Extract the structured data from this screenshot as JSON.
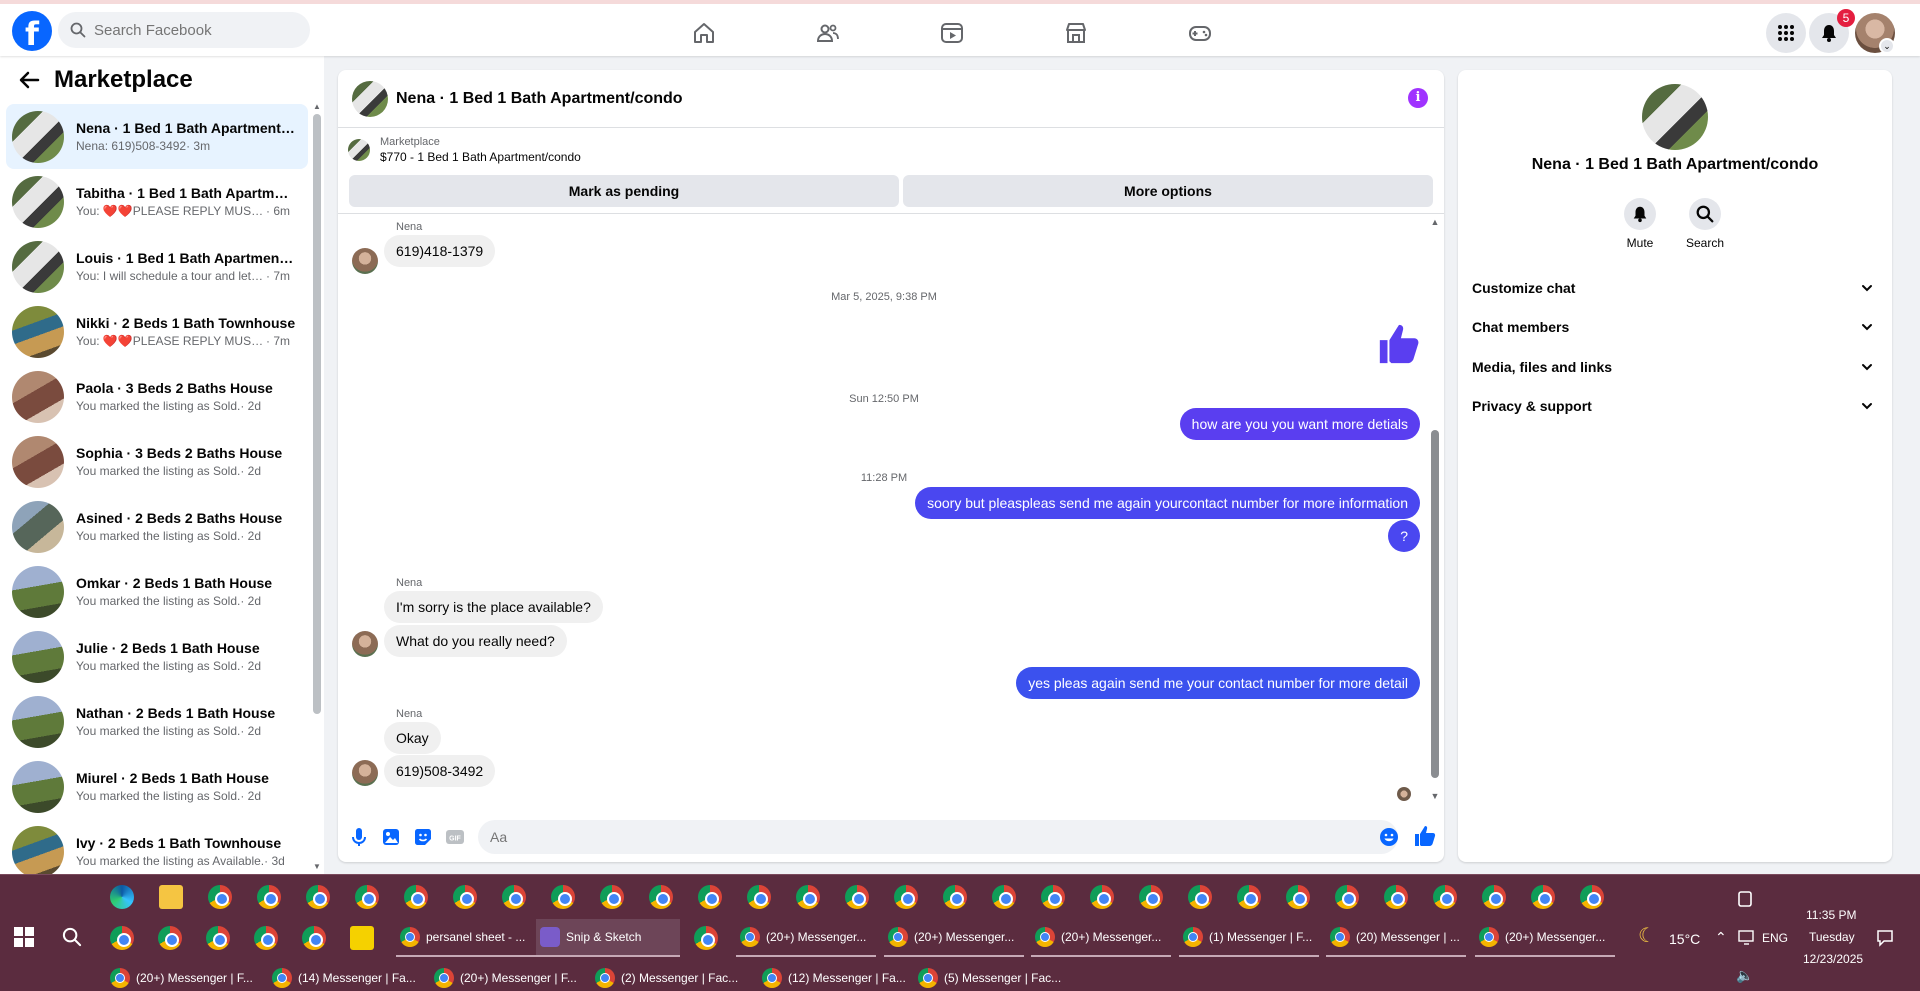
{
  "topbar": {
    "logo": "f",
    "search_placeholder": "Search Facebook",
    "notifications_count": "5"
  },
  "sidebar": {
    "title": "Marketplace",
    "chats": [
      {
        "name": "Nena · 1 Bed 1 Bath Apartment/condo",
        "preview": "Nena: 619)508-3492",
        "time": " · 3m",
        "active": true,
        "photo": "sb-photo-1"
      },
      {
        "name": "Tabitha · 1 Bed 1 Bath Apartment/condo",
        "preview": "You: ❤️❤️PLEASE REPLY MUST WANT",
        "time": " · 6m",
        "active": false,
        "photo": "sb-photo-1"
      },
      {
        "name": "Louis · 1 Bed 1 Bath Apartment/condo",
        "preview": "You: I will schedule a tour and let you",
        "time": " · 7m",
        "active": false,
        "photo": "sb-photo-1"
      },
      {
        "name": "Nikki · 2 Beds 1 Bath Townhouse",
        "preview": "You: ❤️❤️PLEASE REPLY MUST WANT",
        "time": " · 7m",
        "active": false,
        "photo": "sb-photo-2"
      },
      {
        "name": "Paola · 3 Beds 2 Baths House",
        "preview": "You marked the listing as Sold.",
        "time": " · 2d",
        "active": false,
        "photo": "sb-photo-3"
      },
      {
        "name": "Sophia · 3 Beds 2 Baths House",
        "preview": "You marked the listing as Sold.",
        "time": " · 2d",
        "active": false,
        "photo": "sb-photo-3"
      },
      {
        "name": "Asined · 2 Beds 2 Baths House",
        "preview": "You marked the listing as Sold.",
        "time": " · 2d",
        "active": false,
        "photo": "sb-photo-4"
      },
      {
        "name": "Omkar · 2 Beds 1 Bath House",
        "preview": "You marked the listing as Sold.",
        "time": " · 2d",
        "active": false,
        "photo": "sb-photo-5"
      },
      {
        "name": "Julie · 2 Beds 1 Bath House",
        "preview": "You marked the listing as Sold.",
        "time": " · 2d",
        "active": false,
        "photo": "sb-photo-5"
      },
      {
        "name": "Nathan · 2 Beds 1 Bath House",
        "preview": "You marked the listing as Sold.",
        "time": " · 2d",
        "active": false,
        "photo": "sb-photo-5"
      },
      {
        "name": "Miurel · 2 Beds 1 Bath House",
        "preview": "You marked the listing as Sold.",
        "time": " · 2d",
        "active": false,
        "photo": "sb-photo-5"
      },
      {
        "name": "Ivy · 2 Beds 1 Bath Townhouse",
        "preview": "You marked the listing as Available.",
        "time": " · 3d",
        "active": false,
        "photo": "sb-photo-2"
      }
    ]
  },
  "chat": {
    "title": "Nena · 1 Bed 1 Bath Apartment/condo",
    "listing_label": "Marketplace",
    "listing_price": "$770 - 1 Bed 1 Bath Apartment/condo",
    "mark_pending": "Mark as pending",
    "more_options": "More options",
    "sender_name": "Nena",
    "messages": {
      "m1": "619)418-1379",
      "stamp1": "Mar 5, 2025, 9:38 PM",
      "stamp2": "Sun 12:50 PM",
      "out1": "how are you  you want more detials",
      "stamp3": "11:28 PM",
      "out2": "soory but pleaspleas send me again yourcontact number for more information",
      "out3": "?",
      "in2": "I'm sorry is the place available?",
      "in3": "What do you really need?",
      "out4": "yes  pleas again send me your contact number  for more detail",
      "in4": "Okay",
      "in5": "619)508-3492"
    },
    "composer_placeholder": "Aa"
  },
  "panel": {
    "name": "Nena · 1 Bed 1 Bath Apartment/condo",
    "mute": "Mute",
    "search": "Search",
    "rows": [
      "Customize chat",
      "Chat members",
      "Media, files and links",
      "Privacy & support"
    ]
  },
  "taskbar": {
    "apps_row2": [
      {
        "label": "persanel sheet - ...",
        "kind": "chrome"
      },
      {
        "label": "Snip & Sketch",
        "kind": "snip"
      },
      {
        "label": "(20+) Messenger...",
        "kind": "chrome"
      },
      {
        "label": "(20+) Messenger...",
        "kind": "chrome"
      },
      {
        "label": "(20+) Messenger...",
        "kind": "chrome"
      },
      {
        "label": "(1) Messenger | F...",
        "kind": "chrome"
      },
      {
        "label": "(20) Messenger | ...",
        "kind": "chrome"
      },
      {
        "label": "(20+) Messenger...",
        "kind": "chrome"
      }
    ],
    "apps_row3": [
      "(20+) Messenger | F...",
      "(14) Messenger | Fa...",
      "(20+) Messenger | F...",
      "(2) Messenger | Fac...",
      "(12) Messenger | Fa...",
      "(5) Messenger | Fac..."
    ],
    "weather": "15°C",
    "language": "ENG",
    "time": "11:35 PM",
    "day": "Tuesday",
    "date": "12/23/2025"
  },
  "colors": {
    "accent": "#0866ff",
    "bubble_out": "#5a3ef0",
    "taskbar": "#5b2c3f",
    "info": "#a033ff"
  }
}
